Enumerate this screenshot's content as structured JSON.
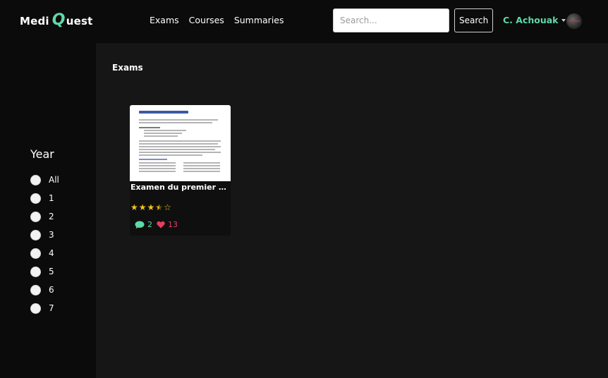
{
  "brand": {
    "prefix": "Medi",
    "q": "Q",
    "suffix": "uest"
  },
  "nav": {
    "links": [
      "Exams",
      "Courses",
      "Summaries"
    ]
  },
  "search": {
    "placeholder": "Search...",
    "value": "",
    "button_label": "Search"
  },
  "user": {
    "name": "C. Achouak"
  },
  "sidebar": {
    "title": "Year",
    "options": [
      "All",
      "1",
      "2",
      "3",
      "4",
      "5",
      "6",
      "7"
    ]
  },
  "main": {
    "section_title": "Exams",
    "cards": [
      {
        "title": "Examen du premier tri...",
        "rating": 3.5,
        "comments": "2",
        "likes": "13"
      }
    ]
  },
  "colors": {
    "accent": "#5fd9a8",
    "star": "#f5c518",
    "heart": "#e83e5c",
    "navbar_bg": "#0b0b0b",
    "content_bg": "#161616"
  },
  "icons": [
    "comment-icon",
    "heart-icon",
    "star-icon",
    "chevron-down-icon",
    "avatar"
  ]
}
